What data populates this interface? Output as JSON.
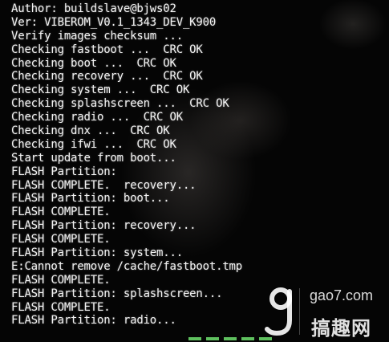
{
  "log_lines": [
    "Author: buildslave@bjws02",
    "Ver: VIBEROM_V0.1_1343_DEV_K900",
    "Verify images checksum ...",
    "Checking fastboot ...  CRC OK",
    "Checking boot ...  CRC OK",
    "Checking recovery ...  CRC OK",
    "Checking system ...  CRC OK",
    "Checking splashscreen ...  CRC OK",
    "Checking radio ...  CRC OK",
    "Checking dnx ...  CRC OK",
    "Checking ifwi ...  CRC OK",
    "Start update from boot...",
    "FLASH Partition:",
    "FLASH COMPLETE.  recovery...",
    "FLASH Partition: boot...",
    "FLASH COMPLETE.",
    "FLASH Partition: recovery...",
    "FLASH COMPLETE.",
    "FLASH Partition: system...",
    "E:Cannot remove /cache/fastboot.tmp",
    "FLASH COMPLETE.",
    "FLASH Partition: splashscreen...",
    "FLASH COMPLETE.",
    "FLASH Partition: radio..."
  ],
  "watermark": {
    "domain": "gao7.com",
    "name": "搞趣网",
    "icon": "g-logo-icon"
  },
  "colors": {
    "text": "#f2f2f2",
    "background": "#050505",
    "progress": "#7cff7c"
  }
}
